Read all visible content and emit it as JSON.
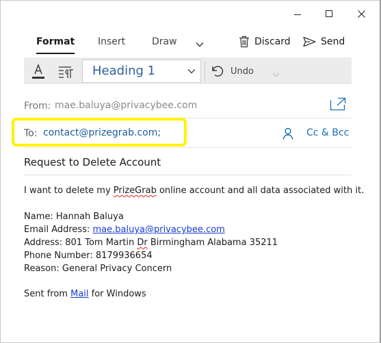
{
  "window": {
    "controls": [
      "minimize",
      "maximize",
      "close"
    ]
  },
  "tabs": [
    {
      "label": "Format",
      "active": true
    },
    {
      "label": "Insert",
      "active": false
    },
    {
      "label": "Draw",
      "active": false
    }
  ],
  "actions": {
    "discard_label": "Discard",
    "send_label": "Send"
  },
  "toolbar": {
    "style_value": "Heading 1",
    "undo_label": "Undo"
  },
  "header": {
    "from_label": "From:",
    "from_value": "mae.baluya@privacybee.com",
    "to_label": "To:",
    "to_value": "contact@prizegrab.com;",
    "cc_bcc_label": "Cc & Bcc",
    "highlight_color": "#fff200"
  },
  "subject": "Request to Delete Account",
  "body": {
    "line1_before": "I want to delete my ",
    "line1_brand": "PrizeGrab",
    "line1_after": " online account and all data associated with it.",
    "name": "Name: Hannah Baluya",
    "email_label": "Email Address: ",
    "email_value": "mae.baluya@privacybee.com",
    "address_before": "Address: 801 Tom Martin ",
    "address_dr": "Dr",
    "address_after": " Birmingham Alabama 35211",
    "phone": "Phone Number: 8179936654",
    "reason": "Reason: General Privacy Concern",
    "signature_before": "Sent from ",
    "signature_link": "Mail",
    "signature_after": " for Windows"
  },
  "colors": {
    "accent_blue": "#1a6fb5",
    "link_blue": "#1a3ad8",
    "style_text": "#2f5f9e"
  }
}
